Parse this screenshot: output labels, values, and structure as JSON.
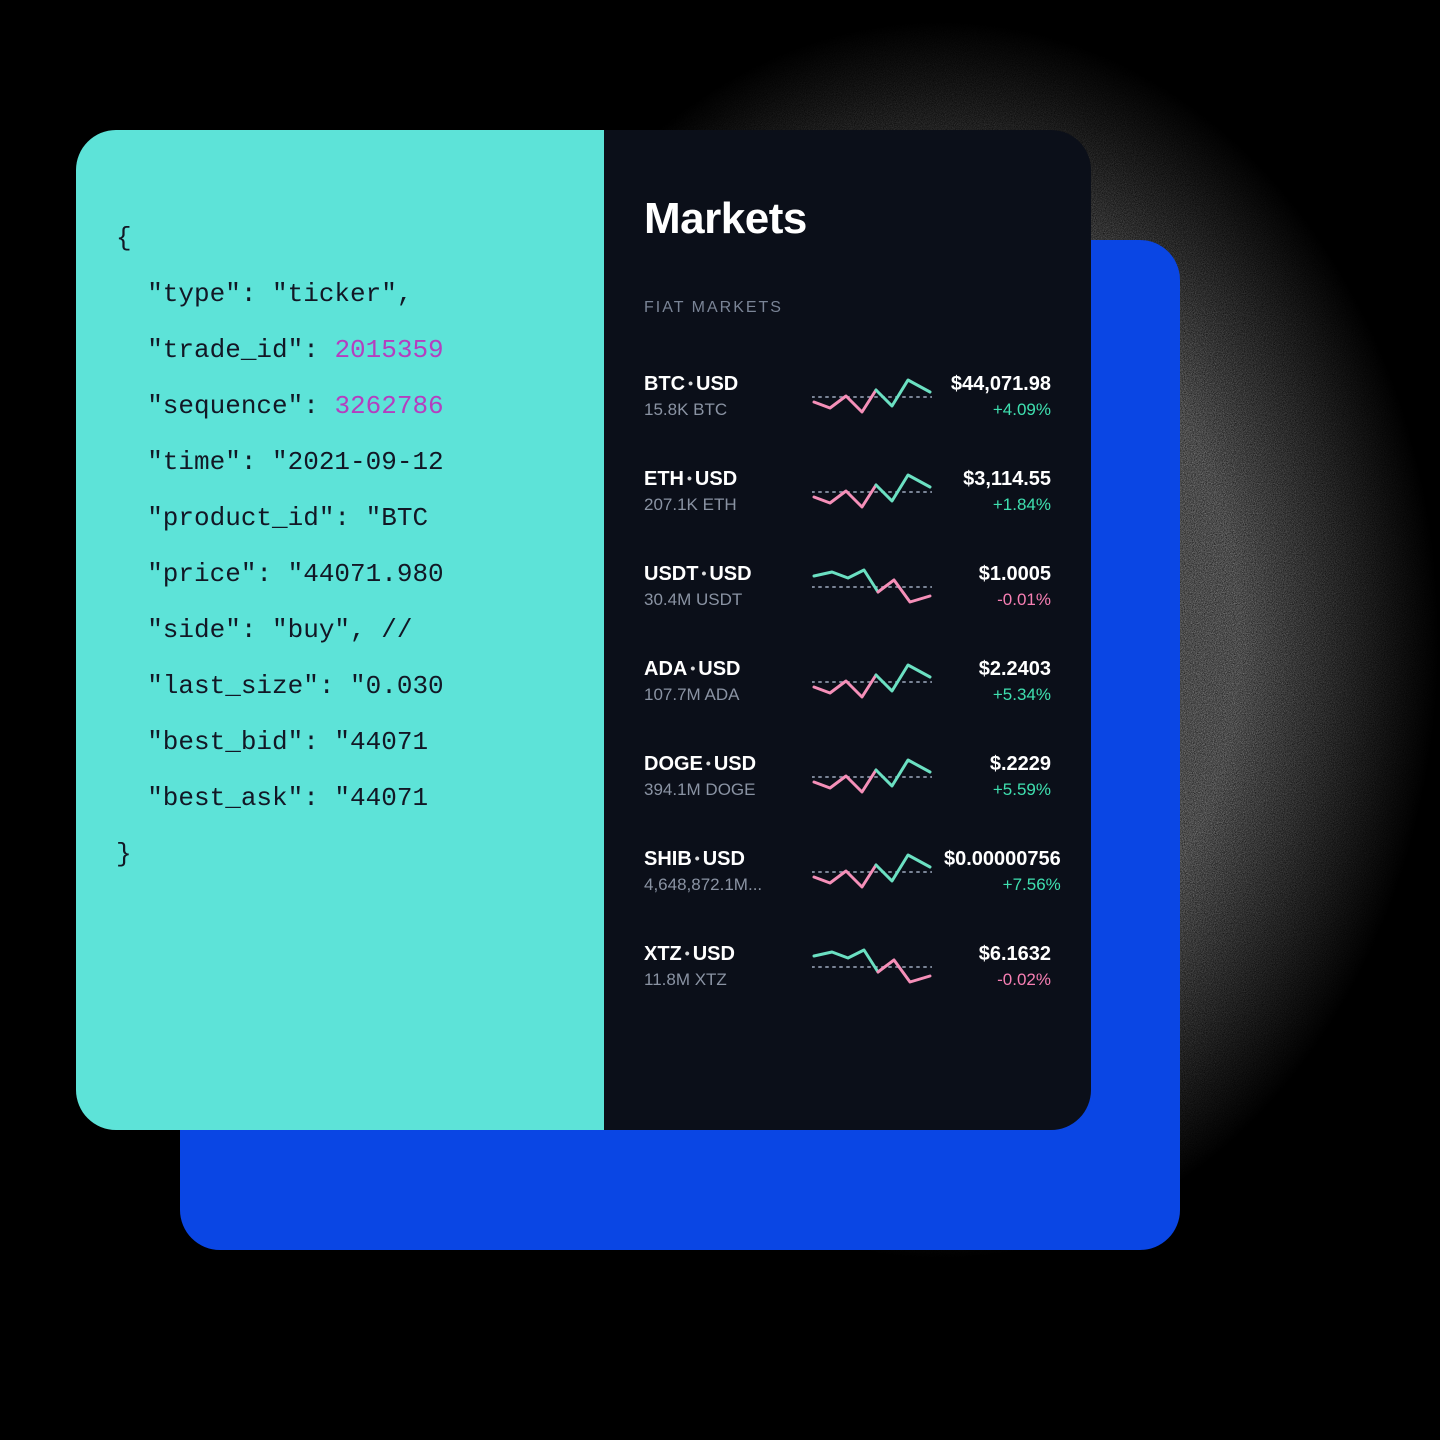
{
  "code": {
    "open": "{",
    "close": "}",
    "lines": [
      {
        "pre": "  \"type\": \"ticker\",",
        "num": ""
      },
      {
        "pre": "  \"trade_id\": ",
        "num": "2015359"
      },
      {
        "pre": "  \"sequence\": ",
        "num": "3262786"
      },
      {
        "pre": "  \"time\": \"2021-09-12",
        "num": ""
      },
      {
        "pre": "  \"product_id\": \"BTC",
        "num": ""
      },
      {
        "pre": "  \"price\": \"44071.980",
        "num": ""
      },
      {
        "pre": "  \"side\": \"buy\", // ",
        "num": ""
      },
      {
        "pre": "  \"last_size\": \"0.030",
        "num": ""
      },
      {
        "pre": "  \"best_bid\": \"44071",
        "num": ""
      },
      {
        "pre": "  \"best_ask\": \"44071",
        "num": ""
      }
    ]
  },
  "markets": {
    "title": "Markets",
    "section": "FIAT MARKETS",
    "rows": [
      {
        "base": "BTC",
        "quote": "USD",
        "volume": "15.8K BTC",
        "price": "$44,071.98",
        "change": "+4.09%",
        "dir": "pos"
      },
      {
        "base": "ETH",
        "quote": "USD",
        "volume": "207.1K ETH",
        "price": "$3,114.55",
        "change": "+1.84%",
        "dir": "pos"
      },
      {
        "base": "USDT",
        "quote": "USD",
        "volume": "30.4M USDT",
        "price": "$1.0005",
        "change": "-0.01%",
        "dir": "neg"
      },
      {
        "base": "ADA",
        "quote": "USD",
        "volume": "107.7M ADA",
        "price": "$2.2403",
        "change": "+5.34%",
        "dir": "pos"
      },
      {
        "base": "DOGE",
        "quote": "USD",
        "volume": "394.1M DOGE",
        "price": "$.2229",
        "change": "+5.59%",
        "dir": "pos"
      },
      {
        "base": "SHIB",
        "quote": "USD",
        "volume": "4,648,872.1M...",
        "price": "$0.00000756",
        "change": "+7.56%",
        "dir": "pos"
      },
      {
        "base": "XTZ",
        "quote": "USD",
        "volume": "11.8M XTZ",
        "price": "$6.1632",
        "change": "-0.02%",
        "dir": "neg"
      }
    ]
  },
  "colors": {
    "teal": "#5DE3D8",
    "blue": "#0A46E4",
    "dark": "#0B0F19",
    "sparkUp": "#6BE0C2",
    "sparkDown": "#F58FB8",
    "dotGrey": "#7A8496"
  }
}
